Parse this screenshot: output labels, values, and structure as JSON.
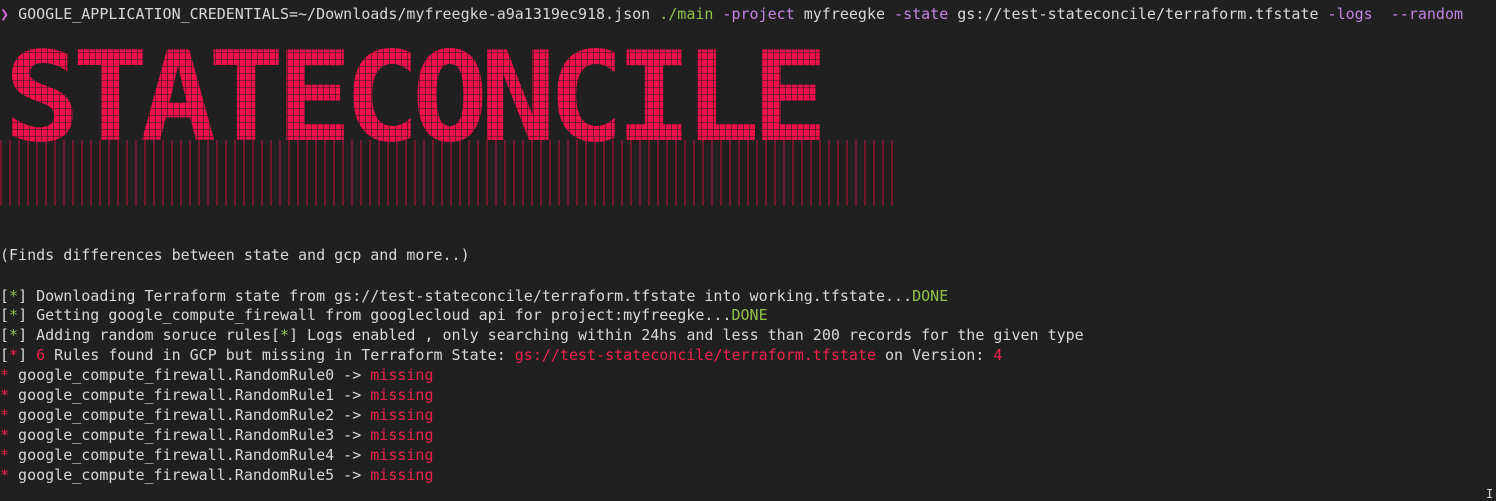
{
  "terminal": {
    "command": {
      "prompt_symbol": "❯",
      "env_assignment": "GOOGLE_APPLICATION_CREDENTIALS=~/Downloads/myfreegke-a9a1319ec918.json",
      "executable": "./main",
      "flag_project": "-project",
      "value_project": "myfreegke",
      "flag_state": "-state",
      "value_state": "gs://test-stateconcile/terraform.tfstate",
      "flag_logs": "-logs",
      "flag_random": "--random"
    },
    "banner": {
      "text": "STATECONCILE"
    },
    "tagline": "(Finds differences between state and gcp and more..)",
    "output": {
      "bracket_open": "[",
      "bracket_close": "]",
      "star": "*",
      "line1_text": " Downloading Terraform state from gs://test-stateconcile/terraform.tfstate into working.tfstate...",
      "line1_status": "DONE",
      "line2_text": " Getting google_compute_firewall from googlecloud api for project:myfreegke...",
      "line2_status": "DONE",
      "line3_text_a": " Adding random soruce rules",
      "line3_text_b": " Logs enabled , only searching within 24hs and less than 200 records for the given type",
      "line4_count": "6",
      "line4_text": " Rules found in GCP but missing in Terraform State: ",
      "line4_path": "gs://test-stateconcile/terraform.tfstate",
      "line4_version_label": " on Version: ",
      "line4_version": "4",
      "missing_items": [
        {
          "name": " google_compute_firewall.RandomRule0 -> ",
          "status": "missing"
        },
        {
          "name": " google_compute_firewall.RandomRule1 -> ",
          "status": "missing"
        },
        {
          "name": " google_compute_firewall.RandomRule2 -> ",
          "status": "missing"
        },
        {
          "name": " google_compute_firewall.RandomRule3 -> ",
          "status": "missing"
        },
        {
          "name": " google_compute_firewall.RandomRule4 -> ",
          "status": "missing"
        },
        {
          "name": " google_compute_firewall.RandomRule5 -> ",
          "status": "missing"
        }
      ]
    }
  },
  "colors": {
    "background": "#202020",
    "text": "#d8d8d8",
    "green": "#8fc24a",
    "red": "#f0224d",
    "purple": "#c384e4",
    "banner": "#f0104a"
  }
}
